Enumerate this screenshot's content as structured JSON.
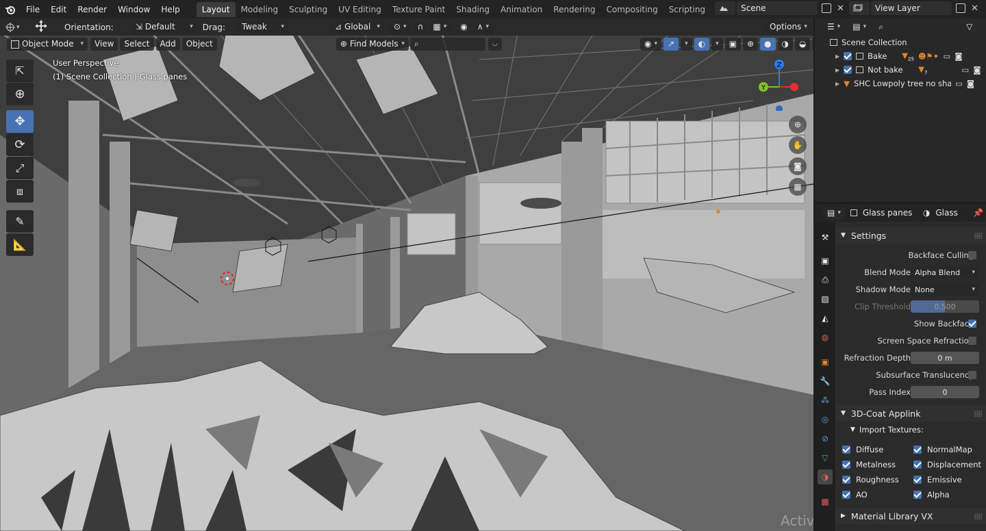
{
  "menubar": {
    "menus": [
      "File",
      "Edit",
      "Render",
      "Window",
      "Help"
    ],
    "workspaces": [
      "Layout",
      "Modeling",
      "Sculpting",
      "UV Editing",
      "Texture Paint",
      "Shading",
      "Animation",
      "Rendering",
      "Compositing",
      "Scripting"
    ],
    "active_workspace": "Layout",
    "scene": "Scene",
    "view_layer": "View Layer"
  },
  "tool_header": {
    "orientation_label": "Orientation:",
    "orientation_value": "Default",
    "drag_label": "Drag:",
    "drag_value": "Tweak",
    "transform_orientation": "Global",
    "options_label": "Options"
  },
  "viewport_header": {
    "mode": "Object Mode",
    "menus": [
      "View",
      "Select",
      "Add",
      "Object"
    ],
    "find_models": "Find Models"
  },
  "viewport": {
    "perspective_label": "User Perspective",
    "collection_label": "(1) Scene Collection | Glass panes",
    "gizmo": {
      "z": "Z",
      "y": "Y"
    },
    "watermark": "Activate Windows"
  },
  "outliner": {
    "root": "Scene Collection",
    "items": [
      {
        "name": "Bake",
        "badge": "25"
      },
      {
        "name": "Not bake",
        "badge": "7"
      },
      {
        "name": "SHC Lowpoly tree no shade"
      }
    ]
  },
  "properties": {
    "object_name": "Glass panes",
    "material_name": "Glass",
    "settings": {
      "header": "Settings",
      "backface_culling": {
        "label": "Backface Culling",
        "checked": false
      },
      "blend_mode": {
        "label": "Blend Mode",
        "value": "Alpha Blend"
      },
      "shadow_mode": {
        "label": "Shadow Mode",
        "value": "None"
      },
      "clip_threshold": {
        "label": "Clip Threshold",
        "value": "0.500"
      },
      "show_backface": {
        "label": "Show Backface",
        "checked": true
      },
      "ssr": {
        "label": "Screen Space Refraction",
        "checked": false
      },
      "refraction_depth": {
        "label": "Refraction Depth",
        "value": "0 m"
      },
      "subsurface": {
        "label": "Subsurface Translucency",
        "checked": false
      },
      "pass_index": {
        "label": "Pass Index",
        "value": "0"
      }
    },
    "applink": {
      "header": "3D-Coat Applink",
      "import_textures": "Import Textures:",
      "left": [
        "Diffuse",
        "Metalness",
        "Roughness",
        "AO"
      ],
      "right": [
        "NormalMap",
        "Displacement",
        "Emissive",
        "Alpha"
      ]
    },
    "material_library": "Material Library VX"
  },
  "colors": {
    "accent": "#4772b3",
    "header_bg": "#232323",
    "viewport_bg": "#5b5b5b",
    "panel_bg": "#2b2b2b"
  }
}
